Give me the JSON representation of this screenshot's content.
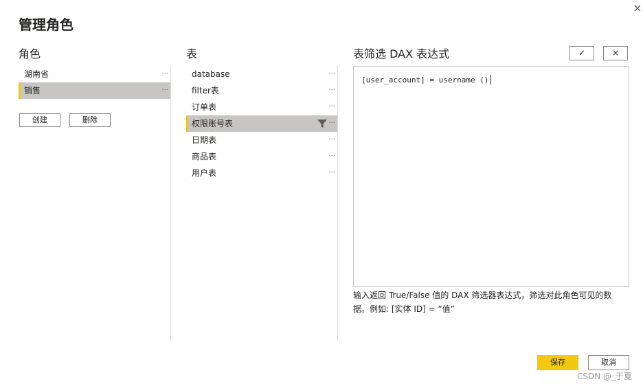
{
  "dialog": {
    "title": "管理角色",
    "close_icon": "×"
  },
  "roles": {
    "header": "角色",
    "items": [
      {
        "label": "湖南省",
        "more": "...",
        "selected": false
      },
      {
        "label": "销售",
        "more": "...",
        "selected": true
      }
    ],
    "create_label": "创建",
    "delete_label": "删除"
  },
  "tables": {
    "header": "表",
    "items": [
      {
        "label": "database",
        "more": "...",
        "selected": false
      },
      {
        "label": "filter表",
        "more": "...",
        "selected": false
      },
      {
        "label": "订单表",
        "more": "...",
        "selected": false
      },
      {
        "label": "权限账号表",
        "more": "...",
        "selected": true,
        "has_filter": true
      },
      {
        "label": "日期表",
        "more": "...",
        "selected": false
      },
      {
        "label": "商品表",
        "more": "...",
        "selected": false
      },
      {
        "label": "用户表",
        "more": "...",
        "selected": false
      }
    ]
  },
  "filter": {
    "header": "表筛选 DAX 表达式",
    "confirm_icon": "✓",
    "cancel_icon": "×",
    "expression": "[user_account] = username ()",
    "hint": "输入返回 True/False 值的 DAX 筛选器表达式，筛选对此角色可见的数据。例如: [实体 ID] = “值”"
  },
  "footer": {
    "save_label": "保存",
    "cancel_label": "取消"
  },
  "watermark": "CSDN @_于夏",
  "colors": {
    "accent": "#f2c811",
    "selected_bg": "#c8c6c4",
    "border": "#c8c6c4"
  }
}
